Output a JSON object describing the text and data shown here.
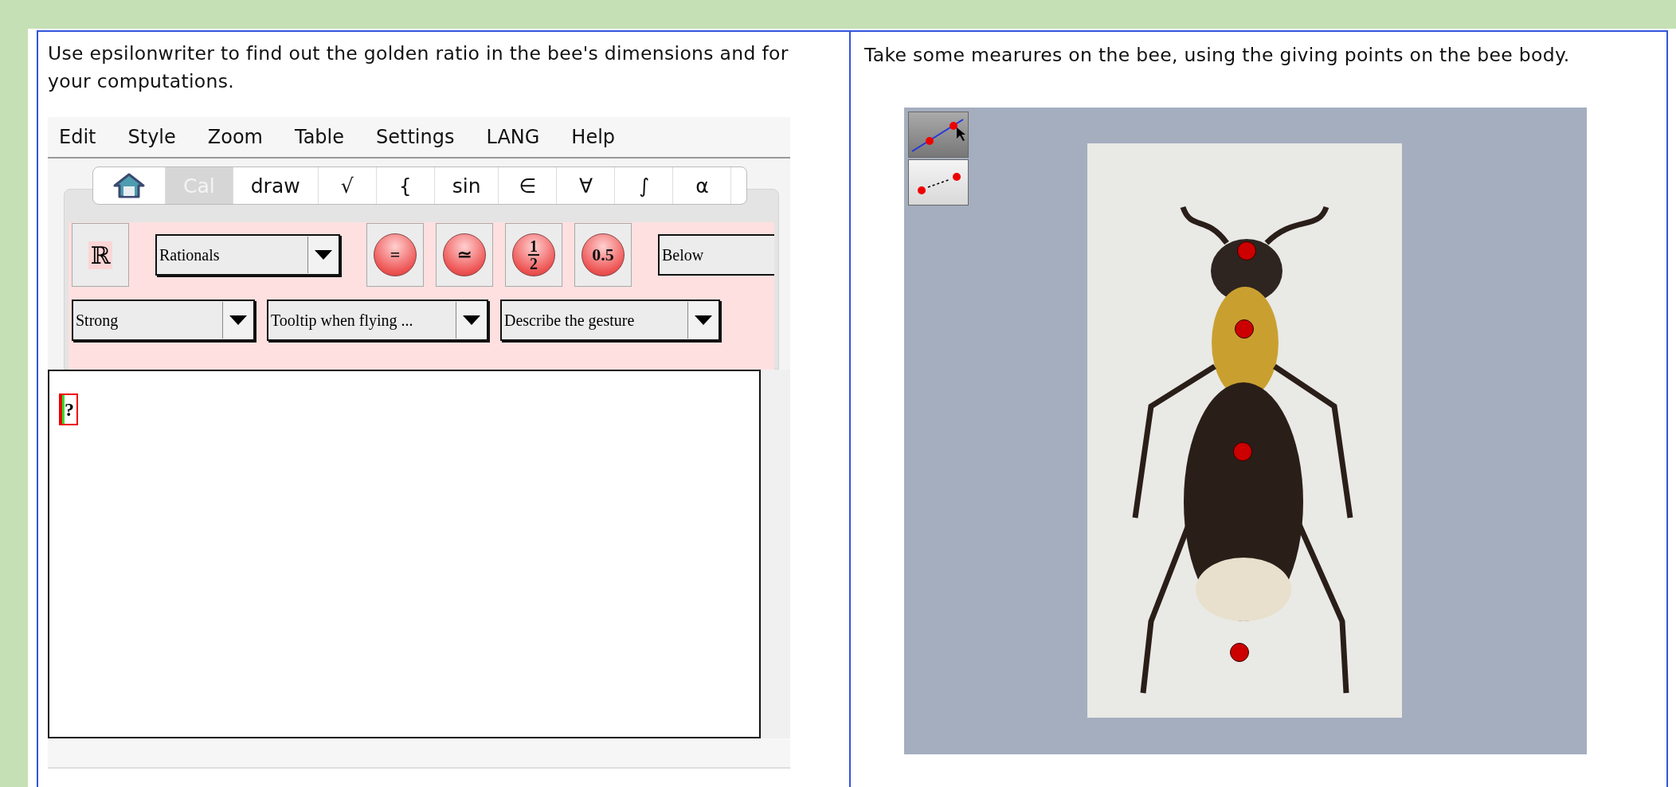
{
  "left_cell": {
    "instruction": "Use epsilonwriter to find out the golden ratio in the bee's dimensions and for your computations.",
    "editor": {
      "menu": [
        "Edit",
        "Style",
        "Zoom",
        "Table",
        "Settings",
        "LANG",
        "Help"
      ],
      "tabs": [
        {
          "kind": "home",
          "selected": false
        },
        {
          "kind": "text",
          "label": "Cal",
          "selected": true
        },
        {
          "kind": "text",
          "label": "draw",
          "selected": false
        },
        {
          "kind": "text",
          "label": "√",
          "selected": false
        },
        {
          "kind": "text",
          "label": "{",
          "selected": false
        },
        {
          "kind": "text",
          "label": "sin",
          "selected": false
        },
        {
          "kind": "text",
          "label": "∈",
          "selected": false
        },
        {
          "kind": "text",
          "label": "∀",
          "selected": false
        },
        {
          "kind": "text",
          "label": "∫",
          "selected": false
        },
        {
          "kind": "text",
          "label": "α",
          "selected": false
        }
      ],
      "toolbar_row_1": [
        {
          "kind": "square",
          "label": "ℝ"
        },
        {
          "kind": "dropdown",
          "label": "Rationals"
        },
        {
          "kind": "round",
          "label": "="
        },
        {
          "kind": "round",
          "label": "≃"
        },
        {
          "kind": "fraction",
          "numerator": "1",
          "denominator": "2"
        },
        {
          "kind": "round",
          "label": "0.5"
        },
        {
          "kind": "cutfield",
          "label": "Below"
        }
      ],
      "toolbar_row_2": [
        {
          "kind": "dropdown",
          "label": "Strong"
        },
        {
          "kind": "dropdown",
          "label": "Tooltip when flying ..."
        },
        {
          "kind": "dropdown",
          "label": "Describe the gesture"
        }
      ],
      "content": "?"
    }
  },
  "right_cell": {
    "instruction": "Take some mearures on the bee, using the giving points on the bee body."
  }
}
